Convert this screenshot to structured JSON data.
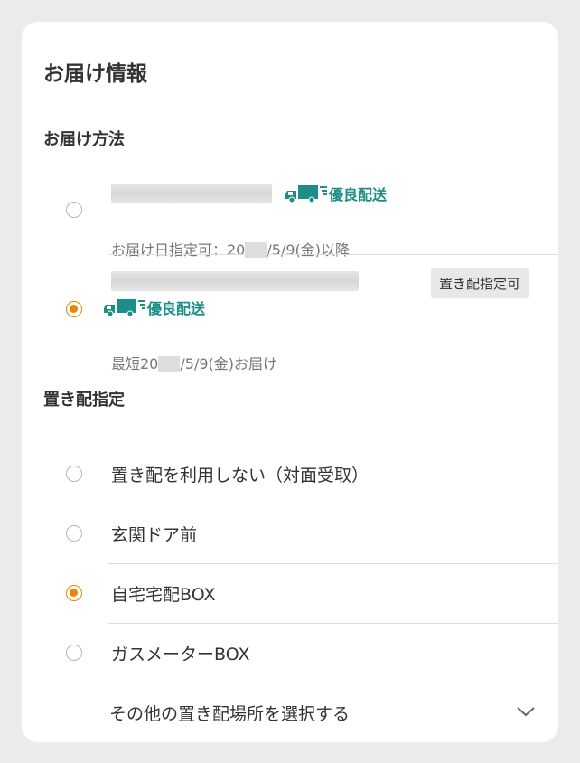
{
  "title": "お届け情報",
  "delivery_method": {
    "heading": "お届け方法",
    "options": [
      {
        "badge": "優良配送",
        "detail_prefix": "お届け日指定可：20",
        "detail_suffix": "/5/9(金)以降",
        "selected": false
      },
      {
        "tag": "置き配指定可",
        "badge": "優良配送",
        "detail_prefix": "最短20",
        "detail_suffix": "/5/9(金)お届け",
        "selected": true
      }
    ]
  },
  "okihai": {
    "heading": "置き配指定",
    "options": [
      {
        "label": "置き配を利用しない（対面受取）",
        "selected": false
      },
      {
        "label": "玄関ドア前",
        "selected": false
      },
      {
        "label": "自宅宅配BOX",
        "selected": true
      },
      {
        "label": "ガスメーターBOX",
        "selected": false
      }
    ],
    "more_label": "その他の置き配場所を選択する"
  },
  "colors": {
    "accent": "#f08300",
    "badge": "#1b8f87",
    "background": "#ebebeb"
  },
  "icons": {
    "badge_icon": "truck-icon",
    "more_icon": "chevron-down-icon"
  }
}
